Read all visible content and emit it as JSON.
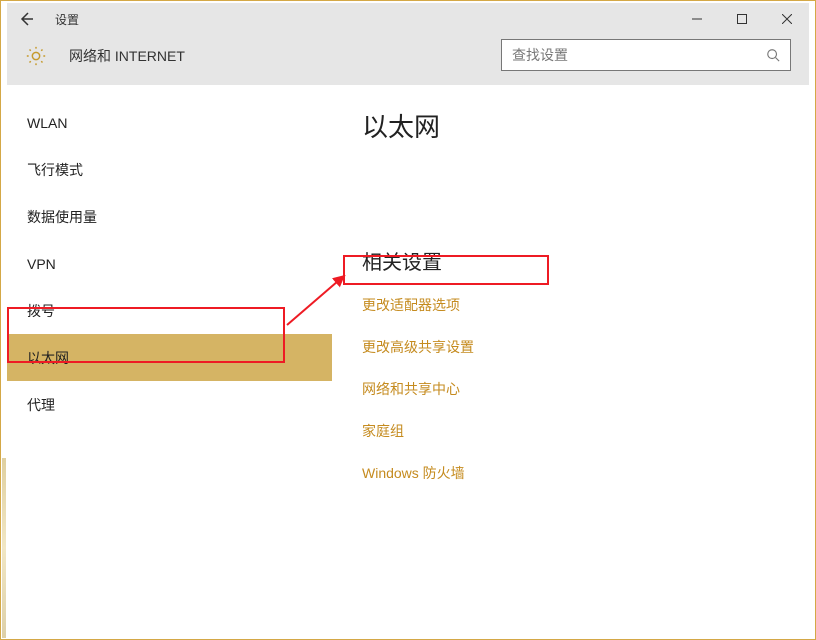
{
  "window": {
    "title": "设置"
  },
  "header": {
    "section": "网络和 INTERNET"
  },
  "search": {
    "placeholder": "查找设置"
  },
  "sidebar": {
    "items": [
      {
        "label": "WLAN",
        "selected": false
      },
      {
        "label": "飞行模式",
        "selected": false
      },
      {
        "label": "数据使用量",
        "selected": false
      },
      {
        "label": "VPN",
        "selected": false
      },
      {
        "label": "拨号",
        "selected": false
      },
      {
        "label": "以太网",
        "selected": true
      },
      {
        "label": "代理",
        "selected": false
      }
    ]
  },
  "content": {
    "heading": "以太网",
    "related_heading": "相关设置",
    "links": [
      {
        "label": "更改适配器选项"
      },
      {
        "label": "更改高级共享设置"
      },
      {
        "label": "网络和共享中心"
      },
      {
        "label": "家庭组"
      },
      {
        "label": "Windows 防火墙"
      }
    ]
  }
}
